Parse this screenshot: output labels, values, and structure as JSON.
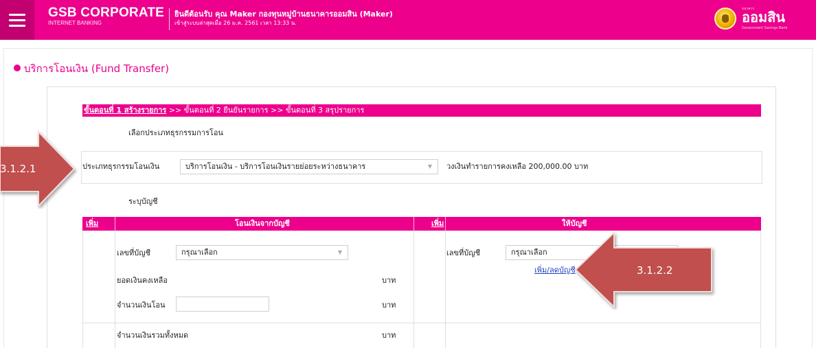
{
  "header": {
    "brand_title": "GSB CORPORATE",
    "brand_sub": "INTERNET BANKING",
    "welcome": "ยินดีต้อนรับ คุณ Maker กองทุนหมู่บ้านธนาคารออมสิน (Maker)",
    "last_login": "เข้าสู่ระบบล่าสุดเมื่อ 26 ม.ค. 2561 เวลา 13:33 น.",
    "logo_text": "ออมสิน",
    "logo_small": "Government Savings Bank",
    "logo_tiny": "ธนาคาร"
  },
  "page": {
    "title": "บริการโอนเงิน (Fund Transfer)"
  },
  "steps": {
    "step1": "ขั้นตอนที่ 1 สร้างรายการ",
    "rest": " >> ขั้นตอนที่ 2 ยืนยันรายการ >> ขั้นตอนที่ 3 สรุปรายการ"
  },
  "transaction": {
    "section_label": "เลือกประเภทธุรกรรมการโอน",
    "type_label": "ประเภทธุรกรรมโอนเงิน",
    "type_value": "บริการโอนเงิน - บริการโอนเงินรายย่อยระหว่างธนาคาร",
    "limit_text": "วงเงินทำรายการคงเหลือ 200,000.00 บาท"
  },
  "accounts": {
    "section_label": "ระบุบัญชี",
    "add_left": "เพิ่ม",
    "from_header": "โอนเงินจากบัญชี",
    "add_right": "เพิ่ม",
    "to_header": "ให้บัญชี",
    "account_no_label": "เลขที่บัญชี",
    "select_placeholder": "กรุณาเลือก",
    "balance_label": "ยอดเงินคงเหลือ",
    "amount_label": "จำนวนเงินโอน",
    "total_label": "จำนวนเงินรวมทั้งหมด",
    "baht": "บาท",
    "to_account_no_label": "เลขที่บัญชี",
    "to_select_placeholder": "กรุณาเลือก",
    "add_remove_link": "เพิ่ม/ลดบัญชี"
  },
  "callouts": {
    "c1": "3.1.2.1",
    "c2": "3.1.2.2",
    "color": "#c0504d"
  },
  "colors": {
    "brand": "#ec008c"
  }
}
